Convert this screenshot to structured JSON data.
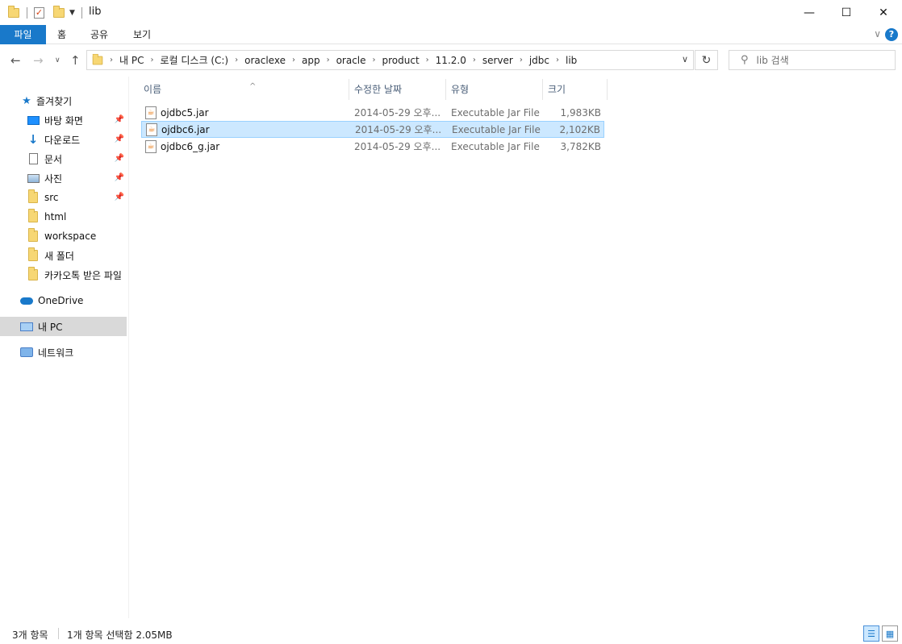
{
  "window": {
    "title": "lib",
    "minimize": "—",
    "maximize": "☐",
    "close": "✕"
  },
  "ribbon": {
    "file_tab": "파일",
    "tabs": [
      "홈",
      "공유",
      "보기"
    ],
    "expand": "∨",
    "help": "?"
  },
  "address": {
    "crumbs": [
      "내 PC",
      "로컬 디스크 (C:)",
      "oraclexe",
      "app",
      "oracle",
      "product",
      "11.2.0",
      "server",
      "jdbc",
      "lib"
    ],
    "separator": "›",
    "dropdown": "∨",
    "refresh": "↻"
  },
  "search": {
    "placeholder": "lib 검색"
  },
  "sidebar": {
    "quick_access": "즐겨찾기",
    "items": [
      {
        "label": "바탕 화면",
        "pinned": true
      },
      {
        "label": "다운로드",
        "pinned": true
      },
      {
        "label": "문서",
        "pinned": true
      },
      {
        "label": "사진",
        "pinned": true
      },
      {
        "label": "src",
        "pinned": true
      },
      {
        "label": "html",
        "pinned": false
      },
      {
        "label": "workspace",
        "pinned": false
      },
      {
        "label": "새 폴더",
        "pinned": false
      },
      {
        "label": "카카오톡 받은 파일",
        "pinned": false
      }
    ],
    "onedrive": "OneDrive",
    "this_pc": "내 PC",
    "network": "네트워크"
  },
  "columns": {
    "name": "이름",
    "date": "수정한 날짜",
    "type": "유형",
    "size": "크기"
  },
  "files": [
    {
      "name": "ojdbc5.jar",
      "date": "2014-05-29 오후...",
      "type": "Executable Jar File",
      "size": "1,983KB",
      "selected": false
    },
    {
      "name": "ojdbc6.jar",
      "date": "2014-05-29 오후...",
      "type": "Executable Jar File",
      "size": "2,102KB",
      "selected": true
    },
    {
      "name": "ojdbc6_g.jar",
      "date": "2014-05-29 오후...",
      "type": "Executable Jar File",
      "size": "3,782KB",
      "selected": false
    }
  ],
  "status": {
    "count": "3개 항목",
    "selection": "1개 항목 선택함 2.05MB"
  },
  "colors": {
    "accent": "#1979ca",
    "selection_bg": "#cce8ff",
    "selection_border": "#99d1ff"
  }
}
